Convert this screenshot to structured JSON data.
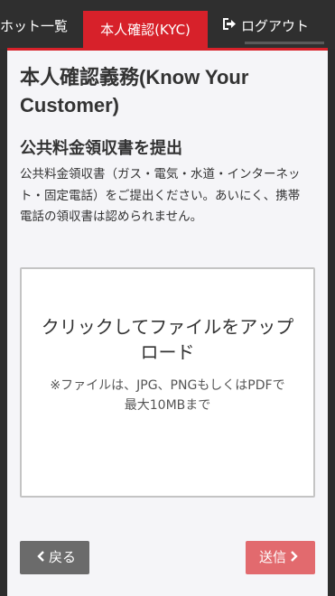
{
  "nav": {
    "prev_label": "ホット一覧",
    "active_label": "本人確認(KYC)",
    "logout_label": "ログアウト",
    "logout_icon": "sign-out-icon"
  },
  "page": {
    "title": "本人確認義務(Know Your Customer)",
    "section_title": "公共料金領収書を提出",
    "description": "公共料金領収書（ガス・電気・水道・インターネット・固定電話）をご提出ください。あいにく、携帯電話の領収書は認められません。"
  },
  "upload": {
    "main_text": "クリックしてファイルをアップロード",
    "note_line1": "※ファイルは、JPG、PNGもしくはPDFで",
    "note_line2": "最大10MBまで"
  },
  "buttons": {
    "back_label": "戻る",
    "submit_label": "送信"
  },
  "colors": {
    "accent": "#d7212a",
    "submit_bg": "#e26a6e",
    "back_bg": "#6b6b6b"
  }
}
